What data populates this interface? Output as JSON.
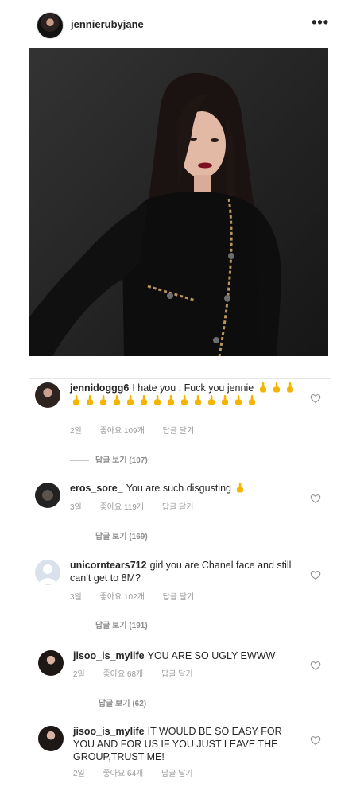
{
  "post": {
    "username": "jennierubyjane",
    "more_label": "•••"
  },
  "comments": [
    {
      "username": "jennidoggg6",
      "text": "I hate you . Fuck you  jennie",
      "emoji_count": 17,
      "time": "2일",
      "likes": "좋아요 109개",
      "reply": "답글 달기",
      "view_replies": "답글 보기 (107)"
    },
    {
      "username": "eros_sore_",
      "text": "You are such disgusting",
      "emoji_count": 1,
      "time": "3일",
      "likes": "좋아요 119개",
      "reply": "답글 달기",
      "view_replies": "답글 보기 (169)"
    },
    {
      "username": "unicorntears712",
      "text": "girl you are Chanel face and still can’t get to 8M?",
      "time": "3일",
      "likes": "좋아요 102개",
      "reply": "답글 달기",
      "view_replies": "답글 보기 (191)"
    },
    {
      "username": "jisoo_is_mylife",
      "text": "YOU ARE SO UGLY EWWW",
      "time": "2일",
      "likes": "좋아요 68개",
      "reply": "답글 달기",
      "view_replies": "답글 보기 (62)"
    },
    {
      "username": "jisoo_is_mylife",
      "text": "IT WOULD BE SO EASY FOR YOU AND FOR US IF YOU JUST LEAVE THE GROUP,TRUST ME!",
      "time": "2일",
      "likes": "좋아요 64개",
      "reply": "답글 달기"
    }
  ],
  "icons": {
    "avatar": "profile-photo",
    "like": "heart-outline-icon",
    "emoji": "middle-finger-emoji"
  },
  "colors": {
    "text": "#262626",
    "meta": "#9a9a9a",
    "emoji": "#f4b400"
  }
}
